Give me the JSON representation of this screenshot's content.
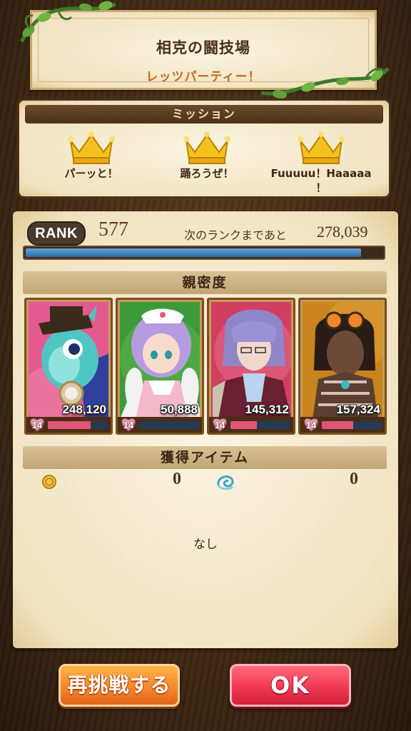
{
  "title": {
    "main": "相克の闘技場",
    "sub": "レッツパーティー！"
  },
  "mission": {
    "header": "ミッション",
    "items": [
      {
        "label": "パーッと！",
        "icon": "crown-icon",
        "achieved": true
      },
      {
        "label": "踊ろうぜ！",
        "icon": "crown-icon",
        "achieved": true
      },
      {
        "label": "Fuuuuu！Haaaaa！",
        "label_line1": "Fuuuuu！Haaaaa",
        "label_line2": "！",
        "icon": "crown-icon",
        "achieved": true
      }
    ]
  },
  "rank": {
    "badge": "RANK",
    "value": "577",
    "next_label": "次のランクまであと",
    "next_value": "278,039",
    "progress": 0.94
  },
  "intimacy": {
    "header": "親密度",
    "cards": [
      {
        "name": "penguin-character",
        "points": "248,120",
        "level": "14",
        "gauge": 0.72
      },
      {
        "name": "nurse-character",
        "points": "50,888",
        "level": "14",
        "gauge": 0.0
      },
      {
        "name": "vampire-character",
        "points": "145,312",
        "level": "14",
        "gauge": 0.44
      },
      {
        "name": "goggles-character",
        "points": "157,324",
        "level": "14",
        "gauge": 0.52
      }
    ]
  },
  "items": {
    "header": "獲得アイテム",
    "gold": {
      "icon": "gold-coin-icon",
      "count": "0"
    },
    "water": {
      "icon": "water-swirl-icon",
      "count": "0"
    },
    "none_text": "なし"
  },
  "buttons": {
    "retry": "再挑戦する",
    "ok": "OK"
  },
  "colors": {
    "background": "#3b2513",
    "parchment": "#f6ecd4",
    "title_sub": "#c46a16",
    "exp_bar": "#3f86c4",
    "gauge_fill": "#e0557a",
    "retry_button": "#f7882a",
    "ok_button": "#f23a52"
  }
}
